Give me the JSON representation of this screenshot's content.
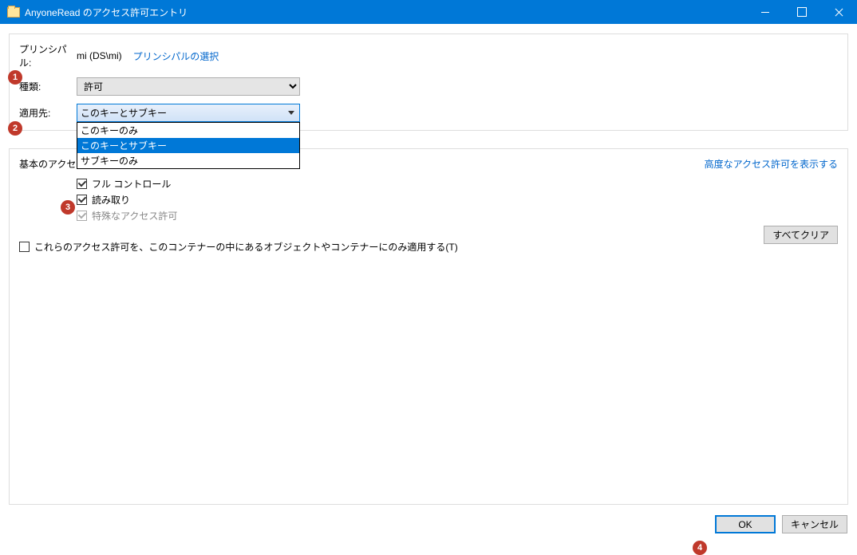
{
  "window": {
    "title": "AnyoneRead のアクセス許可エントリ"
  },
  "principal": {
    "label": "プリンシパル:",
    "value": "mi (DS\\mi)",
    "selectLink": "プリンシパルの選択"
  },
  "type": {
    "label": "種類:",
    "selected": "許可"
  },
  "applyTo": {
    "label": "適用先:",
    "selected": "このキーとサブキー",
    "options": [
      "このキーのみ",
      "このキーとサブキー",
      "サブキーのみ"
    ]
  },
  "basicPerms": {
    "header": "基本のアクセス許可:",
    "advancedLink": "高度なアクセス許可を表示する",
    "items": [
      {
        "label": "フル コントロール",
        "checked": true,
        "disabled": false
      },
      {
        "label": "読み取り",
        "checked": true,
        "disabled": false
      },
      {
        "label": "特殊なアクセス許可",
        "checked": true,
        "disabled": true
      }
    ]
  },
  "containerOnly": {
    "label": "これらのアクセス許可を、このコンテナーの中にあるオブジェクトやコンテナーにのみ適用する(T)",
    "checked": false
  },
  "buttons": {
    "clearAll": "すべてクリア",
    "ok": "OK",
    "cancel": "キャンセル"
  },
  "markers": {
    "m1": "1",
    "m2": "2",
    "m3": "3",
    "m4": "4"
  }
}
